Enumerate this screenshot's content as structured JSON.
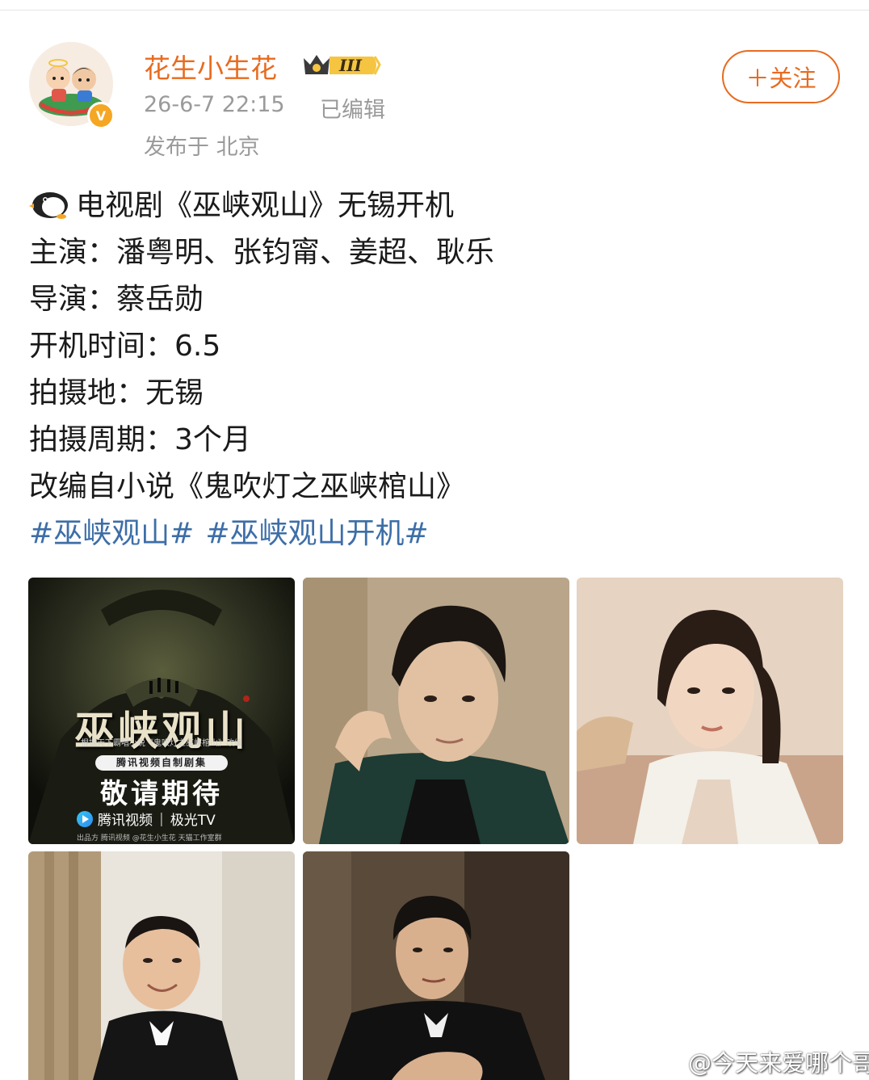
{
  "post": {
    "username": "花生小生花",
    "vip_level": "III",
    "time": "26-6-7 22:15",
    "edited": "已编辑",
    "location": "发布于 北京",
    "follow_label": "＋关注",
    "lines": [
      "电视剧《巫峡观山》无锡开机",
      "主演：潘粤明、张钧甯、姜超、耿乐",
      "导演：蔡岳勋",
      "开机时间：6.5",
      "拍摄地：无锡",
      "拍摄周期：3个月",
      "改编自小说《鬼吹灯之巫峡棺山》"
    ],
    "hashtags": [
      "#巫峡观山#",
      "#巫峡观山开机#"
    ]
  },
  "poster": {
    "title": "巫峡观山",
    "subtitle": "根据天下霸唱小说《鬼吹灯之巫峡棺山》改编",
    "pill": "腾讯视频自制剧集",
    "slogan": "敬请期待",
    "platform1": "腾讯视频",
    "platform2": "极光TV",
    "footer": "出品方  腾讯视频  @花生小生花  天猫工作室群"
  },
  "watermark": "@今天来爱哪个哥哥",
  "colors": {
    "username": "#e86b1f",
    "link": "#3d6ea8",
    "meta": "#9a9a9a",
    "verified": "#f5a623"
  },
  "icons": {
    "penguin": "penguin-emoji-icon",
    "verified": "verified-v-icon",
    "vip": "vip-crown-badge-icon",
    "weibo": "weibo-logo-icon"
  }
}
